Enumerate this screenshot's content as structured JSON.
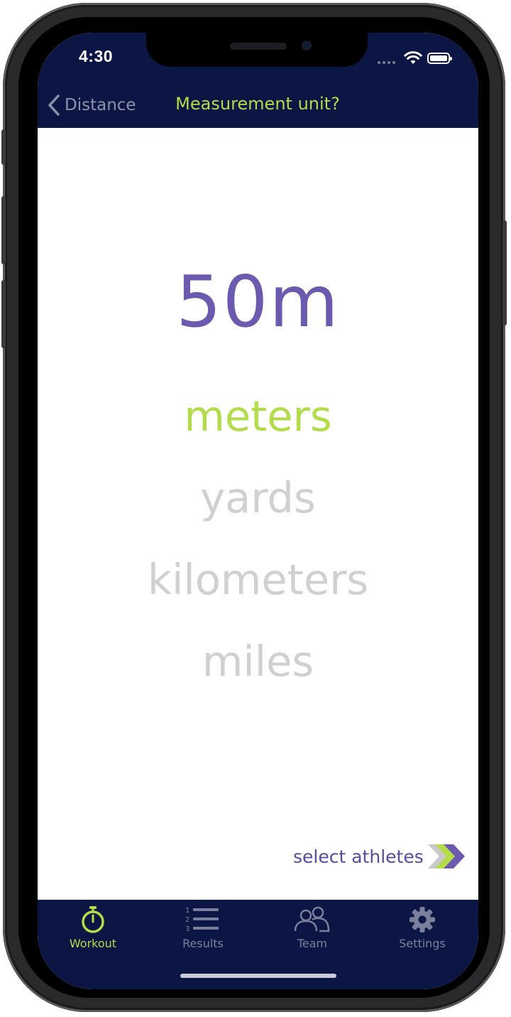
{
  "status_bar": {
    "time": "4:30"
  },
  "nav": {
    "back_label": "Distance",
    "title": "Measurement unit?"
  },
  "main": {
    "value": "50m",
    "options": [
      "meters",
      "yards",
      "kilometers",
      "miles"
    ],
    "selected_option": "meters",
    "next_label": "select athletes"
  },
  "tabs": [
    {
      "label": "Workout",
      "icon": "stopwatch-icon",
      "active": true
    },
    {
      "label": "Results",
      "icon": "numbered-list-icon",
      "active": false
    },
    {
      "label": "Team",
      "icon": "people-icon",
      "active": false
    },
    {
      "label": "Settings",
      "icon": "gear-icon",
      "active": false
    }
  ],
  "colors": {
    "header_bg": "#0c1645",
    "accent_green": "#b3dc4a",
    "accent_purple": "#6b5aae",
    "inactive_gray": "#d0d0d0",
    "tab_inactive": "#7a809c"
  }
}
